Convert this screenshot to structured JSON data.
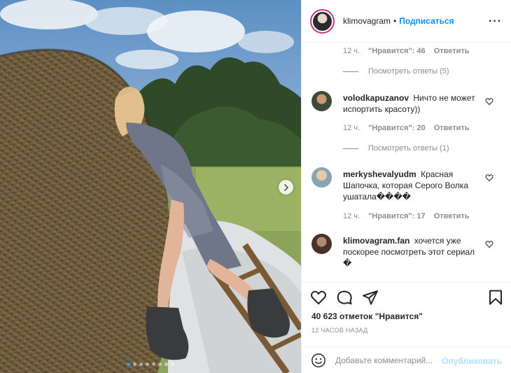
{
  "post": {
    "author": "klimovagram",
    "follow_label": "Подписаться",
    "separator": "•",
    "more_label": "···",
    "carousel": {
      "slide_count": 8,
      "active_index": 0
    },
    "colors": {
      "accent": "#0095f6",
      "ring": "#c13584",
      "muted": "#8e8e8e"
    }
  },
  "comments": {
    "top_meta": {
      "time": "12 ч.",
      "likes": "\"Нравится\": 46",
      "reply": "Ответить"
    },
    "top_view_replies": "Посмотреть ответы (5)",
    "items": [
      {
        "username": "volodkapuzanov",
        "text": "Ничто не может испортить красоту))",
        "time": "12 ч.",
        "likes": "\"Нравится\": 20",
        "reply": "Ответить",
        "view_replies": "Посмотреть ответы (1)"
      },
      {
        "username": "merkyshevalyudm",
        "text": "Красная Шапочка, которая Серого Волка ушатала����",
        "time": "12 ч.",
        "likes": "\"Нравится\": 17",
        "reply": "Ответить"
      },
      {
        "username": "klimovagram.fan",
        "text": "хочется уже поскорее посмотреть этот сериал �"
      }
    ]
  },
  "actions": {
    "icons": [
      "heart-icon",
      "comment-icon",
      "share-icon",
      "bookmark-icon"
    ],
    "likes_count": "40 623 отметок \"Нравится\"",
    "time_ago": "12 ЧАСОВ НАЗАД",
    "comment_placeholder": "Добавьте комментарий...",
    "publish_label": "Опубликовать"
  }
}
